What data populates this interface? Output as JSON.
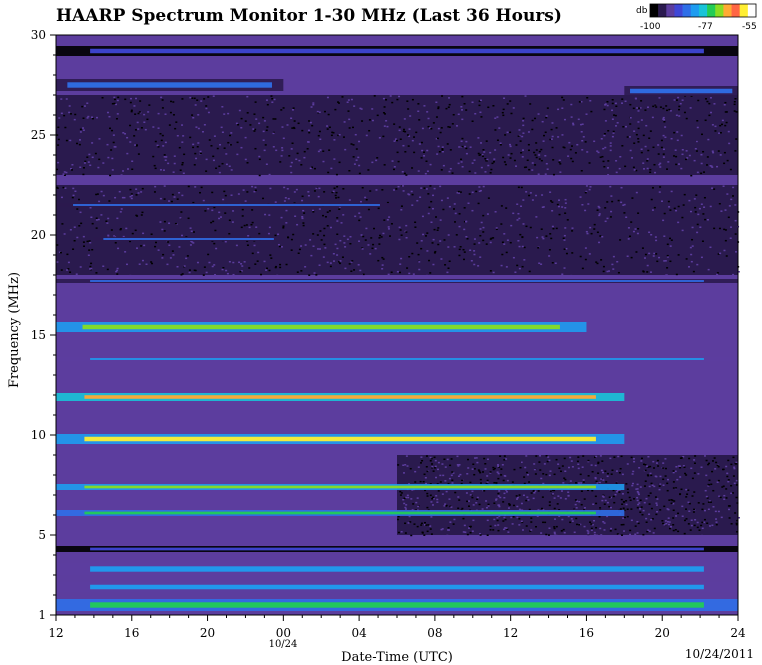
{
  "chart_data": {
    "type": "heatmap",
    "title": "HAARP Spectrum Monitor 1-30 MHz (Last 36 Hours)",
    "xlabel": "Date-Time (UTC)",
    "ylabel": "Frequency (MHz)",
    "x_ticks": [
      "12",
      "16",
      "20",
      "00",
      "04",
      "08",
      "12",
      "16",
      "20",
      "24"
    ],
    "x_sublabel": "10/24",
    "y_ticks": [
      1,
      5,
      10,
      15,
      20,
      25,
      30
    ],
    "ylim": [
      1,
      30
    ],
    "x_hours_range": [
      12,
      48
    ],
    "date_stamp": "10/24/2011",
    "colorbar": {
      "unit": "db",
      "ticks": [
        -100,
        -77,
        -55
      ],
      "min": -100,
      "max": -55
    },
    "bands": [
      {
        "freq": 1.5,
        "width": 0.6,
        "start": 12,
        "end": 48,
        "peak": -72
      },
      {
        "freq": 2.4,
        "width": 0.5,
        "start": 12,
        "end": 48,
        "peak": -80
      },
      {
        "freq": 3.3,
        "width": 0.6,
        "start": 12,
        "end": 48,
        "peak": -82
      },
      {
        "freq": 4.3,
        "width": 0.3,
        "start": 12,
        "end": 48,
        "peak": -88
      },
      {
        "freq": 6.1,
        "width": 0.3,
        "start": 12,
        "end": 42,
        "peak": -72
      },
      {
        "freq": 7.4,
        "width": 0.3,
        "start": 12,
        "end": 42,
        "peak": -70
      },
      {
        "freq": 9.8,
        "width": 0.5,
        "start": 12,
        "end": 42,
        "peak": -68
      },
      {
        "freq": 11.9,
        "width": 0.4,
        "start": 12,
        "end": 42,
        "peak": -64
      },
      {
        "freq": 13.8,
        "width": 0.2,
        "start": 12,
        "end": 48,
        "peak": -80
      },
      {
        "freq": 15.4,
        "width": 0.5,
        "start": 12,
        "end": 40,
        "peak": -70
      },
      {
        "freq": 17.7,
        "width": 0.2,
        "start": 12,
        "end": 48,
        "peak": -84
      },
      {
        "freq": 19.8,
        "width": 0.2,
        "start": 14,
        "end": 24,
        "peak": -86
      },
      {
        "freq": 21.5,
        "width": 0.2,
        "start": 12,
        "end": 30,
        "peak": -86
      },
      {
        "freq": 27.5,
        "width": 0.6,
        "start": 12,
        "end": 24,
        "peak": -84
      },
      {
        "freq": 27.2,
        "width": 0.5,
        "start": 42,
        "end": 48,
        "peak": -84
      },
      {
        "freq": 29.2,
        "width": 0.5,
        "start": 12,
        "end": 48,
        "peak": -88
      }
    ]
  }
}
